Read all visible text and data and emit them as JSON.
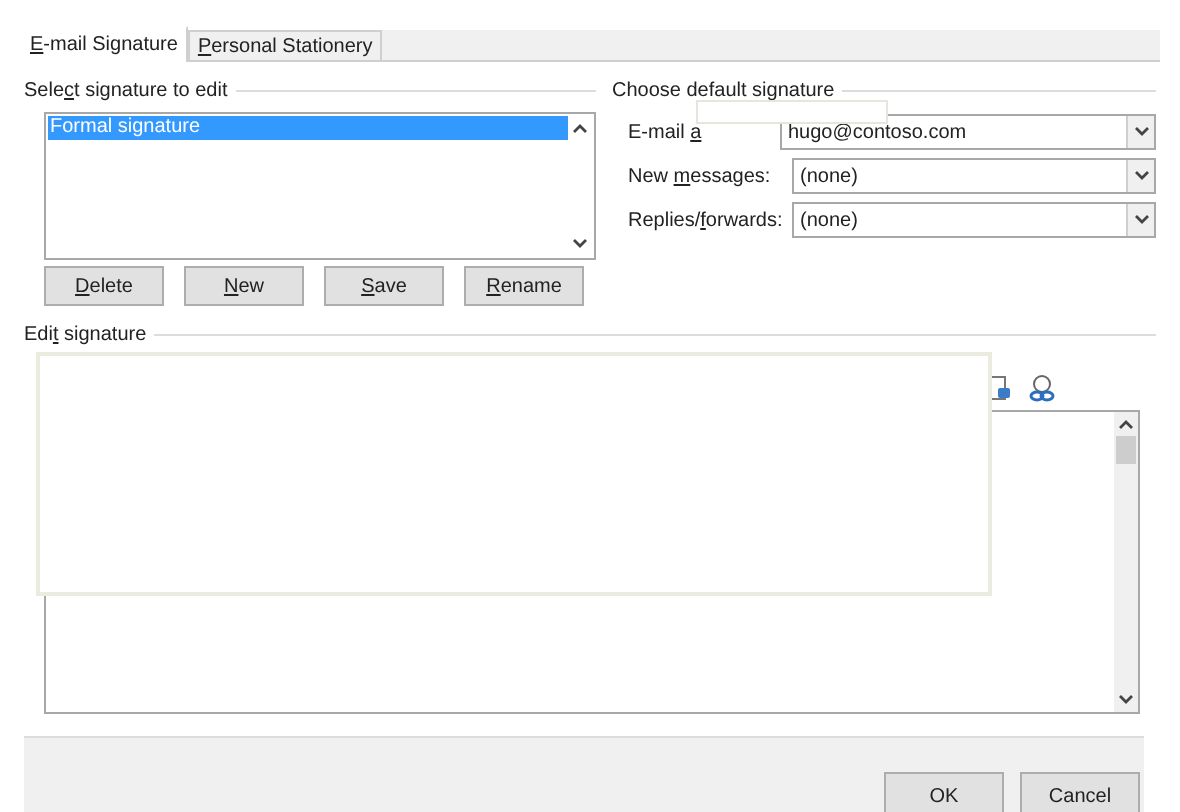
{
  "tabs": [
    {
      "label": {
        "key": "E",
        "after": "-mail Signature"
      },
      "selected": true
    },
    {
      "label": {
        "key": "P",
        "after": "ersonal Stationery"
      },
      "selected": false
    }
  ],
  "select_signature": {
    "title": {
      "before": "Sele",
      "key": "c",
      "after": "t signature to edit"
    },
    "items": [
      {
        "label": "Formal signature",
        "selected": true
      }
    ]
  },
  "signature_buttons": [
    {
      "key": "D",
      "after": "elete"
    },
    {
      "key": "N",
      "after": "ew"
    },
    {
      "key": "S",
      "after": "ave"
    },
    {
      "key": "R",
      "after": "ename"
    }
  ],
  "default_signature": {
    "title": "Choose default signature",
    "fields": [
      {
        "label": {
          "before": "E-mail ",
          "key": "a"
        },
        "value": "hugo@contoso.com"
      },
      {
        "label": {
          "before": "New ",
          "key": "m",
          "after": "essages:"
        },
        "value": "(none)"
      },
      {
        "label": {
          "before": "Replies/",
          "key": "f",
          "after": "orwards:"
        },
        "value": "(none)"
      }
    ]
  },
  "edit_signature": {
    "title": {
      "before": "Edi",
      "key": "t",
      "after": " signature"
    }
  },
  "buttons": [
    "OK",
    "Cancel"
  ]
}
